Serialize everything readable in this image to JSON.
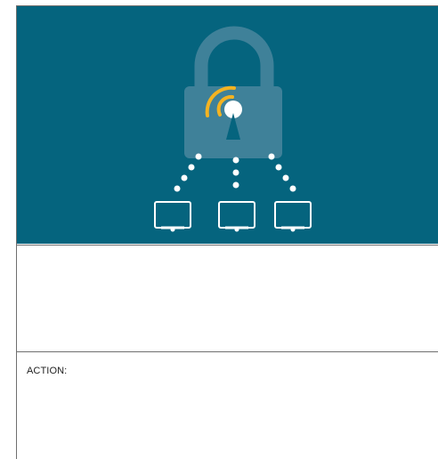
{
  "banner": {
    "background_color": "#05647e",
    "lock_color": "#3f8199",
    "signal_color": "#f4b321",
    "dot_color": "#ffffff",
    "icons": [
      "padlock-icon",
      "wifi-signal-icon",
      "monitor-icon",
      "monitor-icon",
      "monitor-icon"
    ]
  },
  "form": {
    "action_label": "ACTION:"
  }
}
